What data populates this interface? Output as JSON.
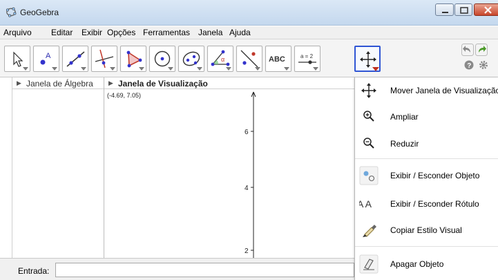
{
  "window": {
    "title": "GeoGebra"
  },
  "menu": [
    "Arquivo",
    "Editar",
    "Exibir",
    "Opções",
    "Ferramentas",
    "Janela",
    "Ajuda"
  ],
  "toolbar": {
    "tools": [
      {
        "name": "move-tool",
        "icon": "cursor-arrow-icon"
      },
      {
        "name": "point-tool",
        "icon": "point-a-icon",
        "text": "A"
      },
      {
        "name": "line-tool",
        "icon": "line-icon"
      },
      {
        "name": "perpendicular-line-tool",
        "icon": "perpendicular-icon"
      },
      {
        "name": "polygon-tool",
        "icon": "polygon-icon"
      },
      {
        "name": "circle-tool",
        "icon": "circle-icon"
      },
      {
        "name": "conic-tool",
        "icon": "ellipse-icon"
      },
      {
        "name": "angle-tool",
        "icon": "angle-icon",
        "text": "α"
      },
      {
        "name": "reflect-tool",
        "icon": "reflect-icon"
      },
      {
        "name": "text-tool",
        "icon": "text-abc-icon",
        "text": "ABC"
      },
      {
        "name": "slider-tool",
        "icon": "slider-icon",
        "text": "a = 2"
      },
      {
        "name": "move-graphics-view-tool",
        "icon": "move-cross-icon"
      }
    ],
    "accent_color": "#2f55d4"
  },
  "algebra_view": {
    "title": "Janela de Álgebra"
  },
  "graphics_view": {
    "title": "Janela de Visualização",
    "coordinate_readout": "(-4.69, 7.05)",
    "y_ticks": [
      "6",
      "4",
      "2"
    ]
  },
  "input_bar": {
    "label": "Entrada:",
    "value": ""
  },
  "dropdown": {
    "items": [
      {
        "label": "Mover Janela de Visualização",
        "icon": "move-cross-icon"
      },
      {
        "label": "Ampliar",
        "icon": "zoom-in-icon"
      },
      {
        "label": "Reduzir",
        "icon": "zoom-out-icon"
      },
      {
        "label": "Exibir / Esconder Objeto",
        "icon": "show-hide-object-icon"
      },
      {
        "label": "Exibir / Esconder Rótulo",
        "icon": "show-hide-label-icon",
        "text": "A A"
      },
      {
        "label": "Copiar Estilo Visual",
        "icon": "brush-icon"
      },
      {
        "label": "Apagar Objeto",
        "icon": "eraser-icon"
      }
    ]
  }
}
